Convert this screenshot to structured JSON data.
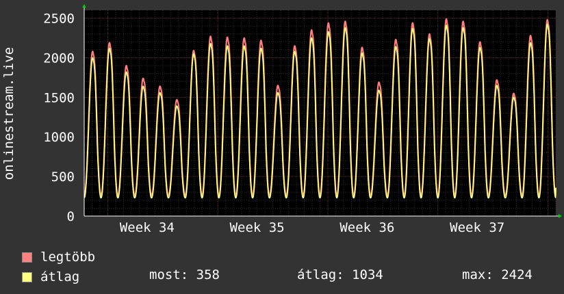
{
  "chart_data": {
    "type": "line",
    "ylabel": "onlinestream.live",
    "ylim": [
      0,
      2600
    ],
    "yticks": [
      0,
      500,
      1000,
      1500,
      2000,
      2500
    ],
    "xlim": [
      0,
      30
    ],
    "x_tick_labels": [
      {
        "label": "Week 34",
        "x": 4.0
      },
      {
        "label": "Week 35",
        "x": 11.0
      },
      {
        "label": "Week 36",
        "x": 18.0
      },
      {
        "label": "Week 37",
        "x": 25.0
      }
    ],
    "grid": true,
    "background": "#000000",
    "grid_color": "#5a2222",
    "day_peaks_max": [
      2080,
      2190,
      1900,
      1740,
      1640,
      1470,
      2090,
      2270,
      2260,
      2250,
      2220,
      1650,
      2150,
      2350,
      2440,
      2460,
      2130,
      1690,
      2230,
      2440,
      2300,
      2490,
      2460,
      2200,
      1720,
      1550,
      2280,
      2480
    ],
    "day_peaks_avg": [
      2000,
      2120,
      1820,
      1640,
      1560,
      1390,
      2050,
      2180,
      2150,
      2150,
      2120,
      1560,
      2080,
      2250,
      2330,
      2380,
      2060,
      1590,
      2140,
      2370,
      2240,
      2410,
      2380,
      2130,
      1650,
      1500,
      2190,
      2424
    ],
    "series": [
      {
        "name": "legtöbb",
        "color": "#ff7d7d"
      },
      {
        "name": "átlag",
        "color": "#ffff80"
      }
    ]
  },
  "legend": {
    "max_label": "legtöbb",
    "avg_label": "átlag",
    "max_color": "#ff8080",
    "avg_color": "#ffff80"
  },
  "stats": {
    "now": "most: 358",
    "avg": "átlag: 1034",
    "max": "max: 2424"
  }
}
